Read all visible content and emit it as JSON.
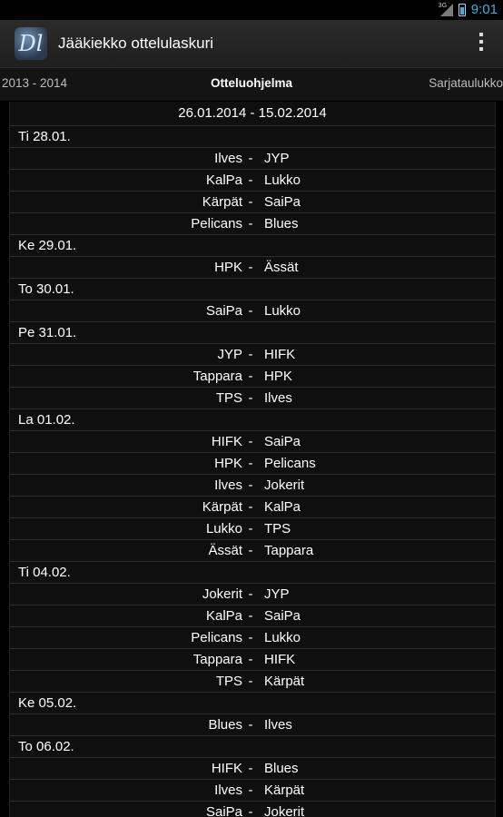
{
  "status": {
    "network": "3G",
    "time": "9:01"
  },
  "app": {
    "title": "Jääkiekko ottelulaskuri",
    "logo_text": "Dl"
  },
  "tabs": {
    "left": "2013 - 2014",
    "center": "Otteluohjelma",
    "right": "Sarjataulukko"
  },
  "range": "26.01.2014 - 15.02.2014",
  "days": [
    {
      "label": "Ti 28.01.",
      "matches": [
        {
          "home": "Ilves",
          "away": "JYP"
        },
        {
          "home": "KalPa",
          "away": "Lukko"
        },
        {
          "home": "Kärpät",
          "away": "SaiPa"
        },
        {
          "home": "Pelicans",
          "away": "Blues"
        }
      ]
    },
    {
      "label": "Ke 29.01.",
      "matches": [
        {
          "home": "HPK",
          "away": "Ässät"
        }
      ]
    },
    {
      "label": "To 30.01.",
      "matches": [
        {
          "home": "SaiPa",
          "away": "Lukko"
        }
      ]
    },
    {
      "label": "Pe 31.01.",
      "matches": [
        {
          "home": "JYP",
          "away": "HIFK"
        },
        {
          "home": "Tappara",
          "away": "HPK"
        },
        {
          "home": "TPS",
          "away": "Ilves"
        }
      ]
    },
    {
      "label": "La 01.02.",
      "matches": [
        {
          "home": "HIFK",
          "away": "SaiPa"
        },
        {
          "home": "HPK",
          "away": "Pelicans"
        },
        {
          "home": "Ilves",
          "away": "Jokerit"
        },
        {
          "home": "Kärpät",
          "away": "KalPa"
        },
        {
          "home": "Lukko",
          "away": "TPS"
        },
        {
          "home": "Ässät",
          "away": "Tappara"
        }
      ]
    },
    {
      "label": "Ti 04.02.",
      "matches": [
        {
          "home": "Jokerit",
          "away": "JYP"
        },
        {
          "home": "KalPa",
          "away": "SaiPa"
        },
        {
          "home": "Pelicans",
          "away": "Lukko"
        },
        {
          "home": "Tappara",
          "away": "HIFK"
        },
        {
          "home": "TPS",
          "away": "Kärpät"
        }
      ]
    },
    {
      "label": "Ke 05.02.",
      "matches": [
        {
          "home": "Blues",
          "away": "Ilves"
        }
      ]
    },
    {
      "label": "To 06.02.",
      "matches": [
        {
          "home": "HIFK",
          "away": "Blues"
        },
        {
          "home": "Ilves",
          "away": "Kärpät"
        },
        {
          "home": "SaiPa",
          "away": "Jokerit"
        }
      ]
    }
  ]
}
